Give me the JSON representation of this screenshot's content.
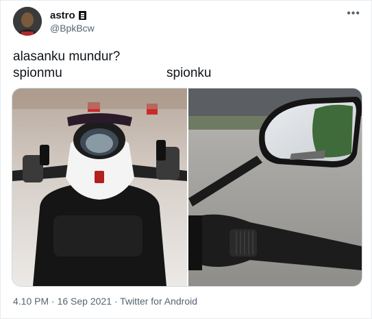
{
  "user": {
    "name": "astro",
    "handle": "@BpkBcw"
  },
  "tweet": {
    "text": "alasanku mundur?",
    "left_label": "spionmu",
    "right_label": "spionku"
  },
  "meta": {
    "timestamp": "4.10 PM · 16 Sep 2021 · Twitter for Android"
  },
  "icons": {
    "more": "more-icon",
    "badge": "badge-icon"
  }
}
